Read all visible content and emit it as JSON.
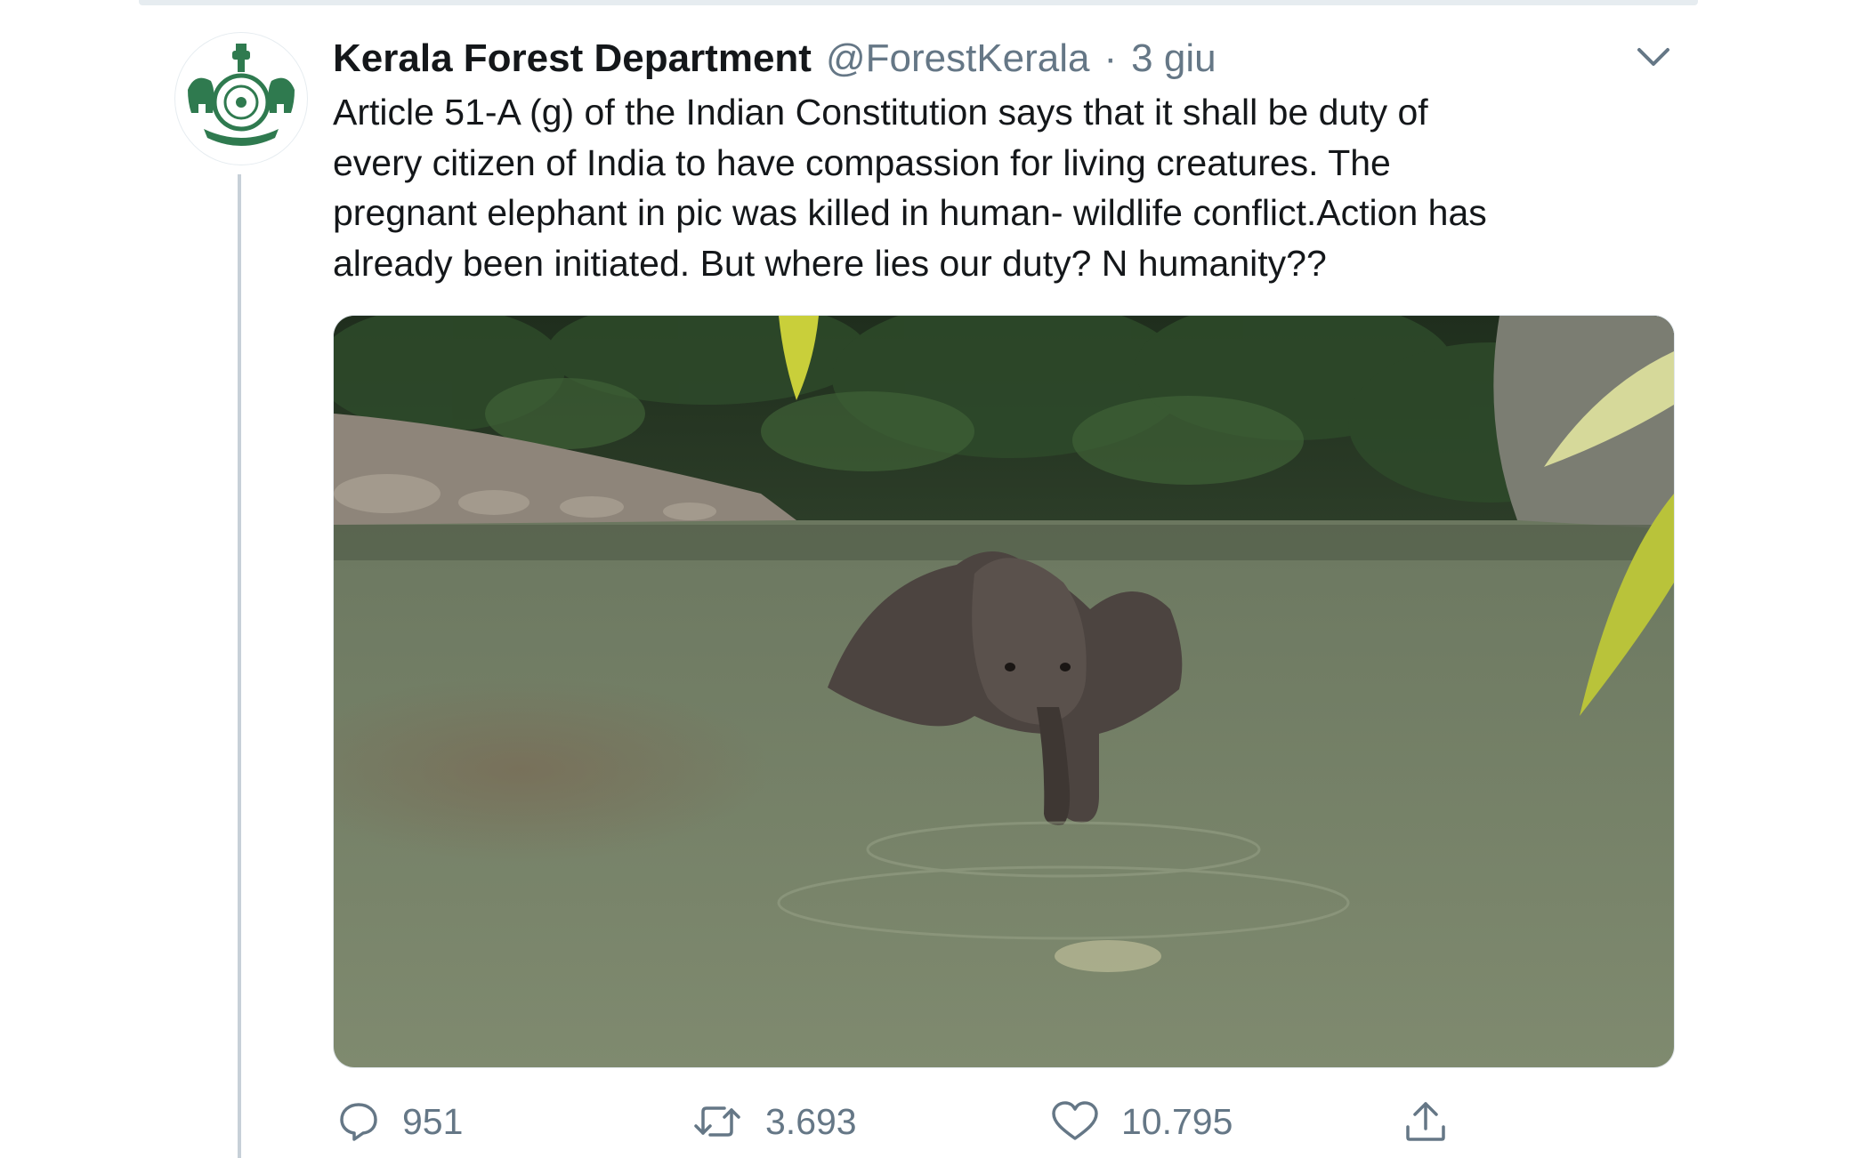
{
  "tweet": {
    "display_name": "Kerala Forest Department",
    "handle": "@ForestKerala",
    "separator": "·",
    "timestamp": "3 giu",
    "text_lines": [
      "Article 51-A (g) of the Indian Constitution says that it shall be duty of",
      "every citizen of India to have compassion for living creatures. The",
      "pregnant elephant in pic was killed in human- wildlife conflict.Action has",
      "already been initiated. But where lies our duty? N humanity??"
    ],
    "media_alt": "elephant-in-river-photo"
  },
  "actions": {
    "reply_count": "951",
    "retweet_count": "3.693",
    "like_count": "10.795"
  },
  "icons": {
    "avatar": "state-emblem-logo",
    "caret": "chevron-down-icon",
    "reply": "reply-bubble-icon",
    "retweet": "retweet-icon",
    "like": "heart-icon",
    "share": "share-upload-icon"
  },
  "colors": {
    "text_primary": "#14171a",
    "text_secondary": "#657786",
    "thread_line": "#c7d0d8",
    "emblem_green": "#2f7a4f"
  }
}
